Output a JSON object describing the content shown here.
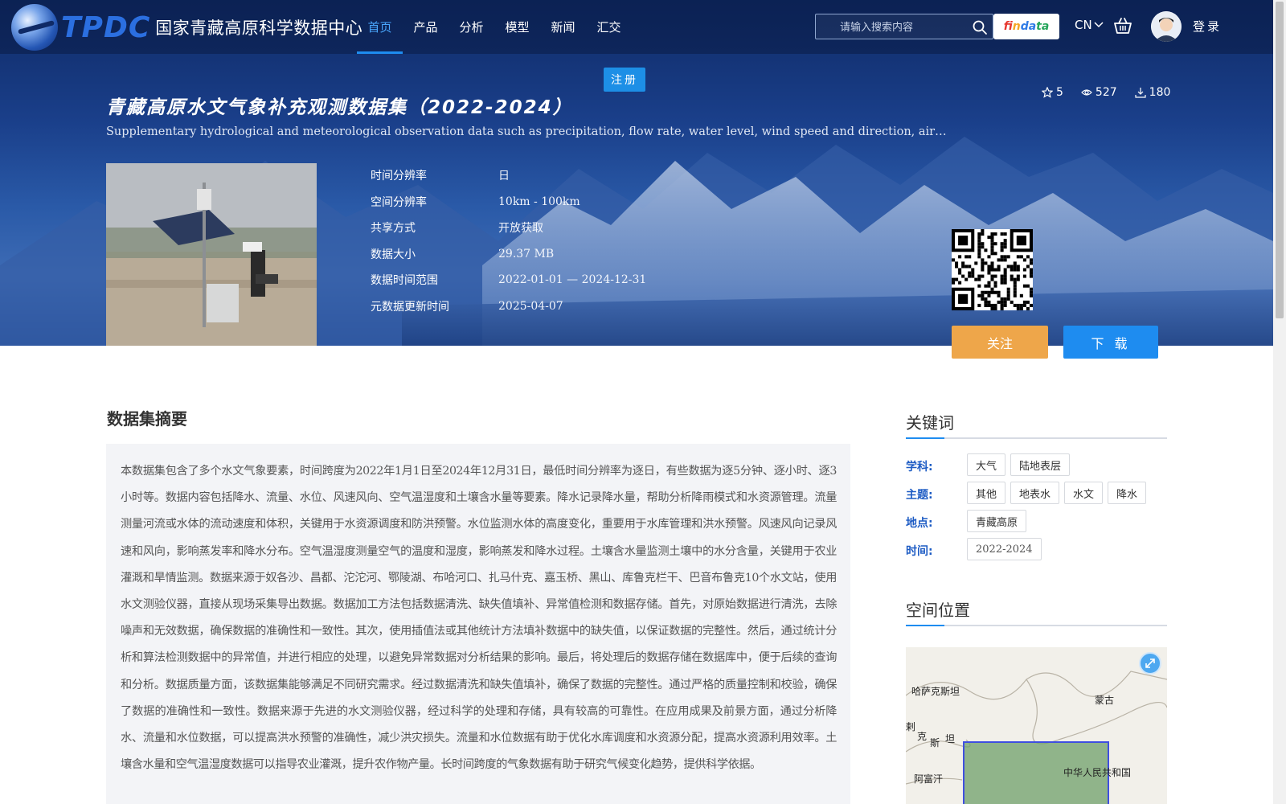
{
  "header": {
    "logo_abbr": "TPDC",
    "logo_name": "国家青藏高原科学数据中心",
    "nav": [
      {
        "label": "首页",
        "active": true
      },
      {
        "label": "产品"
      },
      {
        "label": "分析"
      },
      {
        "label": "模型"
      },
      {
        "label": "新闻"
      },
      {
        "label": "汇交"
      }
    ],
    "search_placeholder": "请输入搜索内容",
    "findata": {
      "p1": "fi",
      "p2": "n",
      "p3": "da",
      "p4": "ta"
    },
    "lang": "CN",
    "login": "登录",
    "register": "注册"
  },
  "dataset": {
    "title": "青藏高原水文气象补充观测数据集（2022-2024）",
    "subtitle": "Supplementary hydrological and meteorological observation data such as precipitation, flow rate, water level, wind speed and direction, air temperature an…",
    "stats": {
      "stars": "5",
      "views": "527",
      "downloads": "180"
    },
    "meta": [
      {
        "key": "时间分辨率",
        "value": "日"
      },
      {
        "key": "空间分辨率",
        "value": "10km - 100km"
      },
      {
        "key": "共享方式",
        "value": "开放获取"
      },
      {
        "key": "数据大小",
        "value": "29.37 MB"
      },
      {
        "key": "数据时间范围",
        "value": "2022-01-01 — 2024-12-31"
      },
      {
        "key": "元数据更新时间",
        "value": "2025-04-07"
      }
    ],
    "follow": "关注",
    "download": "下 载"
  },
  "summary": {
    "title": "数据集摘要",
    "text": "本数据集包含了多个水文气象要素，时间跨度为2022年1月1日至2024年12月31日，最低时间分辨率为逐日，有些数据为逐5分钟、逐小时、逐3小时等。数据内容包括降水、流量、水位、风速风向、空气温湿度和土壤含水量等要素。降水记录降水量，帮助分析降雨模式和水资源管理。流量测量河流或水体的流动速度和体积，关键用于水资源调度和防洪预警。水位监测水体的高度变化，重要用于水库管理和洪水预警。风速风向记录风速和风向，影响蒸发率和降水分布。空气温湿度测量空气的温度和湿度，影响蒸发和降水过程。土壤含水量监测土壤中的水分含量，关键用于农业灌溉和旱情监测。数据来源于奴各沙、昌都、沱沱河、鄂陵湖、布哈河口、扎马什克、嘉玉桥、黑山、库鲁克栏干、巴音布鲁克10个水文站，使用水文测验仪器，直接从现场采集导出数据。数据加工方法包括数据清洗、缺失值填补、异常值检测和数据存储。首先，对原始数据进行清洗，去除噪声和无效数据，确保数据的准确性和一致性。其次，使用插值法或其他统计方法填补数据中的缺失值，以保证数据的完整性。然后，通过统计分析和算法检测数据中的异常值，并进行相应的处理，以避免异常数据对分析结果的影响。最后，将处理后的数据存储在数据库中，便于后续的查询和分析。数据质量方面，该数据集能够满足不同研究需求。经过数据清洗和缺失值填补，确保了数据的完整性。通过严格的质量控制和校验，确保了数据的准确性和一致性。数据来源于先进的水文测验仪器，经过科学的处理和存储，具有较高的可靠性。在应用成果及前景方面，通过分析降水、流量和水位数据，可以提高洪水预警的准确性，减少洪灾损失。流量和水位数据有助于优化水库调度和水资源分配，提高水资源利用效率。土壤含水量和空气温湿度数据可以指导农业灌溉，提升农作物产量。长时间跨度的气象数据有助于研究气候变化趋势，提供科学依据。"
  },
  "keywords": {
    "title": "关键词",
    "rows": [
      {
        "label": "学科:",
        "tags": [
          "大气",
          "陆地表层"
        ]
      },
      {
        "label": "主题:",
        "tags": [
          "其他",
          "地表水",
          "水文",
          "降水"
        ]
      },
      {
        "label": "地点:",
        "tags": [
          "青藏高原"
        ]
      },
      {
        "label": "时间:",
        "tags": [
          "2022-2024"
        ]
      }
    ]
  },
  "spatial": {
    "title": "空间位置",
    "map_labels": [
      "哈萨克斯坦",
      "蒙古",
      "克",
      "斯",
      "坦",
      "阿富汗",
      "中华人民共和国",
      "剌"
    ]
  },
  "colors": {
    "accent": "#1e8cf0",
    "follow": "#eea64a",
    "keyword_label": "#1e5cc4"
  }
}
